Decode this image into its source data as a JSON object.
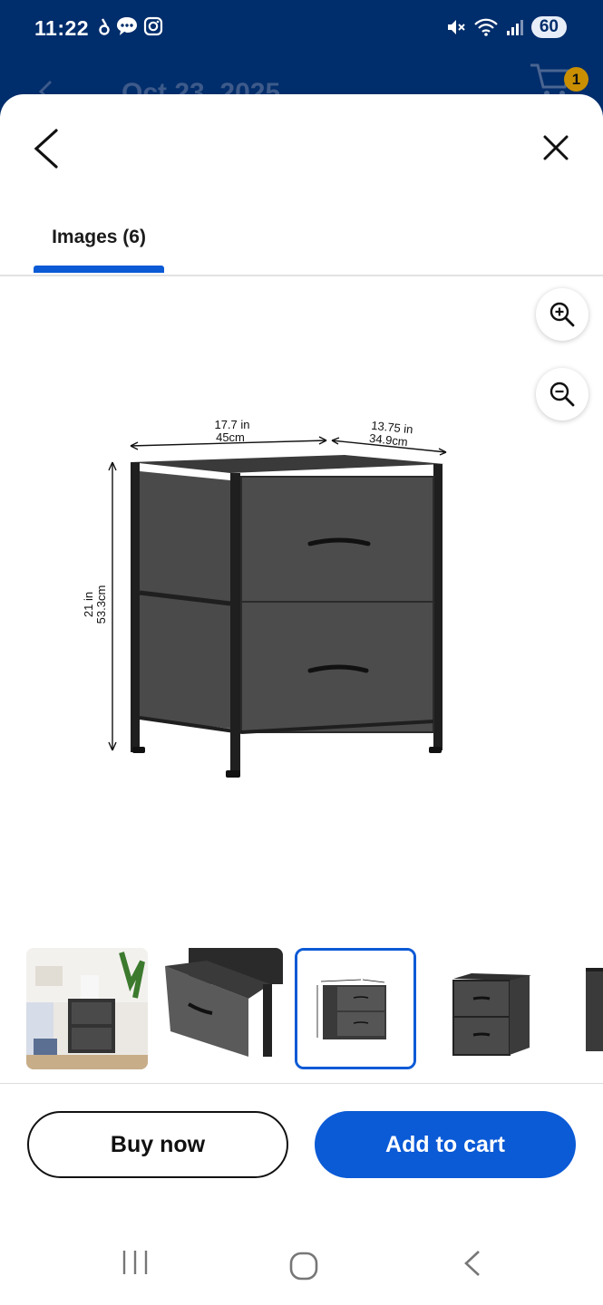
{
  "status_bar": {
    "time": "11:22",
    "battery": "60",
    "left_icons": [
      "drop-icon",
      "chat-bubble-icon",
      "instagram-icon"
    ],
    "right_icons": [
      "mute-icon",
      "wifi-icon",
      "signal-icon"
    ]
  },
  "background_header": {
    "date": "Oct 23, 2025",
    "cart_count": "1"
  },
  "sheet": {
    "tab_label": "Images (6)"
  },
  "main_image": {
    "width_in": "17.7 in",
    "width_cm": "45cm",
    "depth_in": "13.75 in",
    "depth_cm": "34.9cm",
    "height_in": "21 in",
    "height_cm": "53.3cm"
  },
  "thumbnails": [
    {
      "name": "room-scene",
      "selected": false
    },
    {
      "name": "open-drawer",
      "selected": false
    },
    {
      "name": "dimensions",
      "selected": true
    },
    {
      "name": "front-view",
      "selected": false
    },
    {
      "name": "side-view",
      "selected": false
    }
  ],
  "actions": {
    "buy_now": "Buy now",
    "add_to_cart": "Add to cart"
  },
  "colors": {
    "header_bg": "#002d6b",
    "accent": "#0b5ad6",
    "badge": "#c98f00"
  }
}
